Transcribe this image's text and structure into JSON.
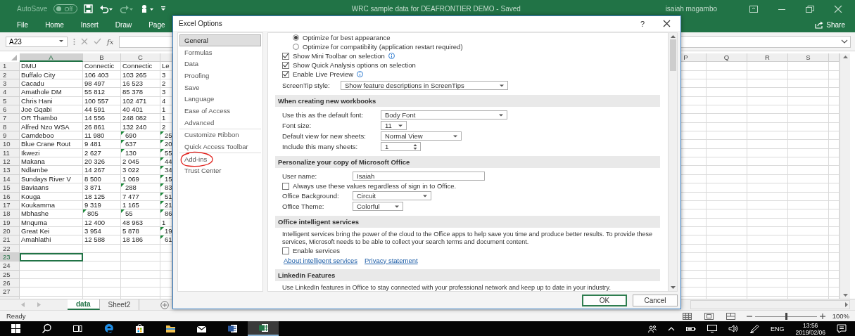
{
  "excel": {
    "title_bar": {
      "autosave": "AutoSave",
      "autosave_toggle": {
        "label": "Off",
        "on": false
      },
      "title": "WRC sample data for DEAFRONTIER DEMO  -  Saved",
      "user": "isaiah magambo"
    },
    "ribbon_tabs": [
      "File",
      "Home",
      "Insert",
      "Draw",
      "Page"
    ],
    "share": "Share",
    "name_box": "A23",
    "function_label": "fx",
    "columns_left": [
      {
        "label": "A",
        "selected": true
      },
      {
        "label": "B",
        "selected": false
      },
      {
        "label": "C",
        "selected": false
      }
    ],
    "columns_right": [
      "P",
      "Q",
      "R",
      "S"
    ],
    "rows": [
      {
        "number": "1",
        "selected": false,
        "dmu": "DMU",
        "cells": [
          {
            "text": "Connectic",
            "flagged": false
          },
          {
            "text": "Connectic",
            "flagged": false
          },
          {
            "text": "Le",
            "flagged": false
          }
        ]
      },
      {
        "number": "2",
        "selected": false,
        "dmu": "Buffalo City",
        "cells": [
          {
            "text": "106 403",
            "flagged": false
          },
          {
            "text": "103 265",
            "flagged": false
          },
          {
            "text": "3",
            "flagged": false
          }
        ]
      },
      {
        "number": "3",
        "selected": false,
        "dmu": "Cacadu",
        "cells": [
          {
            "text": "98 497",
            "flagged": false
          },
          {
            "text": "16 523",
            "flagged": false
          },
          {
            "text": "2",
            "flagged": false
          }
        ]
      },
      {
        "number": "4",
        "selected": false,
        "dmu": "Amathole DM",
        "cells": [
          {
            "text": "55 812",
            "flagged": false
          },
          {
            "text": "85 378",
            "flagged": false
          },
          {
            "text": "3",
            "flagged": false
          }
        ]
      },
      {
        "number": "5",
        "selected": false,
        "dmu": "Chris Hani",
        "cells": [
          {
            "text": "100 557",
            "flagged": false
          },
          {
            "text": "102 471",
            "flagged": false
          },
          {
            "text": "4",
            "flagged": false
          }
        ]
      },
      {
        "number": "6",
        "selected": false,
        "dmu": "Joe Gqabi",
        "cells": [
          {
            "text": "44 591",
            "flagged": false
          },
          {
            "text": "40 401",
            "flagged": false
          },
          {
            "text": "1",
            "flagged": false
          }
        ]
      },
      {
        "number": "7",
        "selected": false,
        "dmu": "OR Thambo",
        "cells": [
          {
            "text": "14 556",
            "flagged": false
          },
          {
            "text": "248 082",
            "flagged": false
          },
          {
            "text": "1",
            "flagged": false
          }
        ]
      },
      {
        "number": "8",
        "selected": false,
        "dmu": "Alfred Nzo WSA",
        "cells": [
          {
            "text": "26 861",
            "flagged": false
          },
          {
            "text": "132 240",
            "flagged": false
          },
          {
            "text": "2",
            "flagged": false
          }
        ]
      },
      {
        "number": "9",
        "selected": false,
        "dmu": "Camdeboo",
        "cells": [
          {
            "text": "11 980",
            "flagged": false
          },
          {
            "text": "690",
            "flagged": true
          },
          {
            "text": "25",
            "flagged": true
          }
        ]
      },
      {
        "number": "10",
        "selected": false,
        "dmu": "Blue Crane Rout",
        "cells": [
          {
            "text": "9 481",
            "flagged": false
          },
          {
            "text": "637",
            "flagged": true
          },
          {
            "text": "20",
            "flagged": true
          }
        ]
      },
      {
        "number": "11",
        "selected": false,
        "dmu": "Ikwezi",
        "cells": [
          {
            "text": "2 627",
            "flagged": false
          },
          {
            "text": "130",
            "flagged": true
          },
          {
            "text": "55",
            "flagged": true
          }
        ]
      },
      {
        "number": "12",
        "selected": false,
        "dmu": "Makana",
        "cells": [
          {
            "text": "20 326",
            "flagged": false
          },
          {
            "text": "2 045",
            "flagged": false
          },
          {
            "text": "44",
            "flagged": true
          }
        ]
      },
      {
        "number": "13",
        "selected": false,
        "dmu": "Ndlambe",
        "cells": [
          {
            "text": "14 267",
            "flagged": false
          },
          {
            "text": "3 022",
            "flagged": false
          },
          {
            "text": "34",
            "flagged": true
          }
        ]
      },
      {
        "number": "14",
        "selected": false,
        "dmu": "Sundays River V",
        "cells": [
          {
            "text": "8 500",
            "flagged": false
          },
          {
            "text": "1 069",
            "flagged": false
          },
          {
            "text": "15",
            "flagged": true
          }
        ]
      },
      {
        "number": "15",
        "selected": false,
        "dmu": "Baviaans",
        "cells": [
          {
            "text": "3 871",
            "flagged": false
          },
          {
            "text": "288",
            "flagged": true
          },
          {
            "text": "83",
            "flagged": true
          }
        ]
      },
      {
        "number": "16",
        "selected": false,
        "dmu": "Kouga",
        "cells": [
          {
            "text": "18 125",
            "flagged": false
          },
          {
            "text": "7 477",
            "flagged": false
          },
          {
            "text": "51",
            "flagged": true
          }
        ]
      },
      {
        "number": "17",
        "selected": false,
        "dmu": "Koukamma",
        "cells": [
          {
            "text": "9 319",
            "flagged": false
          },
          {
            "text": "1 165",
            "flagged": false
          },
          {
            "text": "21",
            "flagged": true
          }
        ]
      },
      {
        "number": "18",
        "selected": false,
        "dmu": "Mbhashe",
        "cells": [
          {
            "text": "805",
            "flagged": true
          },
          {
            "text": "55",
            "flagged": true
          },
          {
            "text": "86",
            "flagged": true
          }
        ]
      },
      {
        "number": "19",
        "selected": false,
        "dmu": "Mnquma",
        "cells": [
          {
            "text": "12 400",
            "flagged": false
          },
          {
            "text": "48 963",
            "flagged": false
          },
          {
            "text": "1",
            "flagged": false
          }
        ]
      },
      {
        "number": "20",
        "selected": false,
        "dmu": "Great Kei",
        "cells": [
          {
            "text": "3 954",
            "flagged": false
          },
          {
            "text": "5 878",
            "flagged": false
          },
          {
            "text": "19",
            "flagged": true
          }
        ]
      },
      {
        "number": "21",
        "selected": false,
        "dmu": "Amahlathi",
        "cells": [
          {
            "text": "12 588",
            "flagged": false
          },
          {
            "text": "18 186",
            "flagged": false
          },
          {
            "text": "61",
            "flagged": true
          }
        ]
      },
      {
        "number": "22",
        "selected": false
      },
      {
        "number": "23",
        "selected": true
      },
      {
        "number": "24",
        "selected": false
      },
      {
        "number": "25",
        "selected": false
      },
      {
        "number": "26",
        "selected": false
      },
      {
        "number": "27",
        "selected": false
      }
    ],
    "sheet_tabs": [
      {
        "label": "data",
        "selected": true
      },
      {
        "label": "Sheet2",
        "selected": false
      }
    ],
    "status": "Ready",
    "zoom_slider": {
      "level": 0.5
    },
    "zoom": "100%"
  },
  "dialog": {
    "title": "Excel Options",
    "help": "?",
    "nav": [
      {
        "items": [
          {
            "label": "General",
            "selected": true,
            "circled": false
          },
          {
            "label": "Formulas",
            "selected": false,
            "circled": false
          },
          {
            "label": "Data",
            "selected": false,
            "circled": false
          },
          {
            "label": "Proofing",
            "selected": false,
            "circled": false
          },
          {
            "label": "Save",
            "selected": false,
            "circled": false
          },
          {
            "label": "Language",
            "selected": false,
            "circled": false
          },
          {
            "label": "Ease of Access",
            "selected": false,
            "circled": false
          },
          {
            "label": "Advanced",
            "selected": false,
            "circled": false
          }
        ]
      },
      {
        "items": [
          {
            "label": "Customize Ribbon",
            "selected": false,
            "circled": false
          },
          {
            "label": "Quick Access Toolbar",
            "selected": false,
            "circled": false
          }
        ]
      },
      {
        "items": [
          {
            "label": "Add-ins",
            "selected": false,
            "circled": true
          },
          {
            "label": "Trust Center",
            "selected": false,
            "circled": false
          }
        ]
      }
    ],
    "sections": [
      {
        "items": [
          {
            "kind": "radio",
            "label": "Optimize for best appearance",
            "selected": true
          },
          {
            "kind": "radio",
            "label": "Optimize for compatibility (application restart required)",
            "selected": false
          },
          {
            "kind": "checkbox",
            "label": "Show Mini Toolbar on selection",
            "checked": true,
            "info": true
          },
          {
            "kind": "checkbox",
            "label": "Show Quick Analysis options on selection",
            "checked": true,
            "info": false
          },
          {
            "kind": "checkbox",
            "label": "Enable Live Preview",
            "checked": true,
            "info": true
          },
          {
            "kind": "select",
            "label": "ScreenTip style:",
            "value": "Show feature descriptions in ScreenTips"
          }
        ]
      },
      {
        "heading": "When creating new workbooks",
        "items": [
          {
            "kind": "select",
            "label": "Use this as the default font:",
            "value": "Body Font"
          },
          {
            "kind": "select",
            "label": "Font size:",
            "value": "11"
          },
          {
            "kind": "select",
            "label": "Default view for new sheets:",
            "value": "Normal View"
          },
          {
            "kind": "spinner",
            "label": "Include this many sheets:",
            "value": "1"
          }
        ]
      },
      {
        "heading": "Personalize your copy of Microsoft Office",
        "items": [
          {
            "kind": "input",
            "label": "User name:",
            "value": "Isaiah"
          },
          {
            "kind": "checkbox",
            "label": "Always use these values regardless of sign in to Office.",
            "checked": false,
            "info": false
          },
          {
            "kind": "select",
            "label": "Office Background:",
            "value": "Circuit"
          },
          {
            "kind": "select",
            "label": "Office Theme:",
            "value": "Colorful"
          }
        ]
      },
      {
        "heading": "Office intelligent services",
        "items": [
          {
            "kind": "paragraph",
            "text": "Intelligent services bring the power of the cloud to the Office apps to help save you time and produce better results. To provide these services, Microsoft needs to be able to collect your search terms and document content."
          },
          {
            "kind": "checkbox",
            "label": "Enable services",
            "checked": false,
            "info": false
          },
          {
            "kind": "links",
            "links": [
              "About intelligent services",
              "Privacy statement"
            ]
          }
        ]
      },
      {
        "heading": "LinkedIn Features",
        "items": [
          {
            "kind": "paragraph",
            "text": "Use LinkedIn features in Office to stay connected with your professional network and keep up to date in your industry."
          }
        ]
      }
    ],
    "buttons": [
      {
        "label": "OK",
        "default": true
      },
      {
        "label": "Cancel",
        "default": false
      }
    ]
  },
  "taskbar": {
    "language": "ENG",
    "time": "13:56",
    "date": "2019/02/06"
  }
}
